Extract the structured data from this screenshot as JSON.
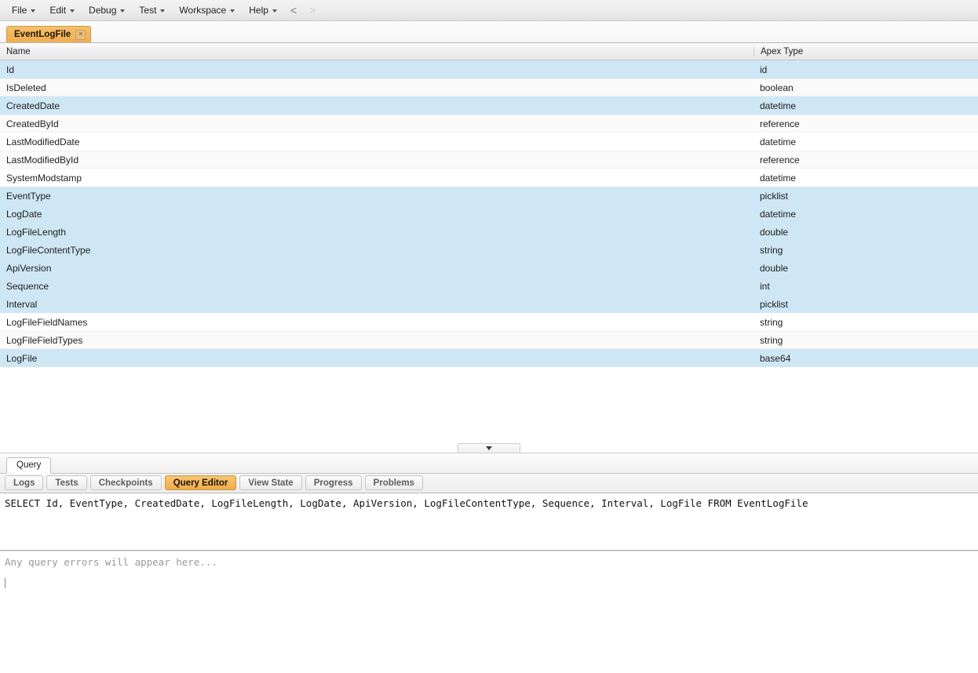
{
  "menubar": {
    "items": [
      {
        "label": "File",
        "has_caret": true
      },
      {
        "label": "Edit",
        "has_caret": true
      },
      {
        "label": "Debug",
        "has_caret": true
      },
      {
        "label": "Test",
        "has_caret": true
      },
      {
        "label": "Workspace",
        "has_caret": true
      },
      {
        "label": "Help",
        "has_caret": true
      }
    ],
    "nav_back": "<",
    "nav_forward": ">"
  },
  "doctabs": {
    "tabs": [
      {
        "label": "EventLogFile",
        "active": true,
        "close_glyph": "×"
      }
    ]
  },
  "schema_table": {
    "columns": [
      "Name",
      "Apex Type"
    ],
    "rows": [
      {
        "name": "Id",
        "type": "id",
        "selected": true
      },
      {
        "name": "IsDeleted",
        "type": "boolean",
        "selected": false
      },
      {
        "name": "CreatedDate",
        "type": "datetime",
        "selected": true
      },
      {
        "name": "CreatedById",
        "type": "reference",
        "selected": false
      },
      {
        "name": "LastModifiedDate",
        "type": "datetime",
        "selected": false
      },
      {
        "name": "LastModifiedById",
        "type": "reference",
        "selected": false
      },
      {
        "name": "SystemModstamp",
        "type": "datetime",
        "selected": false
      },
      {
        "name": "EventType",
        "type": "picklist",
        "selected": true
      },
      {
        "name": "LogDate",
        "type": "datetime",
        "selected": true
      },
      {
        "name": "LogFileLength",
        "type": "double",
        "selected": true
      },
      {
        "name": "LogFileContentType",
        "type": "string",
        "selected": true
      },
      {
        "name": "ApiVersion",
        "type": "double",
        "selected": true
      },
      {
        "name": "Sequence",
        "type": "int",
        "selected": true
      },
      {
        "name": "Interval",
        "type": "picklist",
        "selected": true
      },
      {
        "name": "LogFileFieldNames",
        "type": "string",
        "selected": false
      },
      {
        "name": "LogFileFieldTypes",
        "type": "string",
        "selected": false
      },
      {
        "name": "LogFile",
        "type": "base64",
        "selected": true
      }
    ]
  },
  "query_tab_row": {
    "tabs": [
      {
        "label": "Query",
        "active": true
      }
    ]
  },
  "tool_tabs": {
    "tabs": [
      {
        "label": "Logs",
        "active": false
      },
      {
        "label": "Tests",
        "active": false
      },
      {
        "label": "Checkpoints",
        "active": false
      },
      {
        "label": "Query Editor",
        "active": true
      },
      {
        "label": "View State",
        "active": false
      },
      {
        "label": "Progress",
        "active": false
      },
      {
        "label": "Problems",
        "active": false
      }
    ]
  },
  "query_editor": {
    "value": "SELECT Id, EventType, CreatedDate, LogFileLength, LogDate, ApiVersion, LogFileContentType, Sequence, Interval, LogFile FROM EventLogFile"
  },
  "error_pane": {
    "placeholder": "Any query errors will appear here..."
  },
  "colors": {
    "accent_tab": "#eeae51",
    "row_selected": "#cfe7f5",
    "row_alt": "#fafafa",
    "chrome": "#ececec",
    "text": "#1d1d1d",
    "placeholder_text": "#9a9a9a"
  }
}
